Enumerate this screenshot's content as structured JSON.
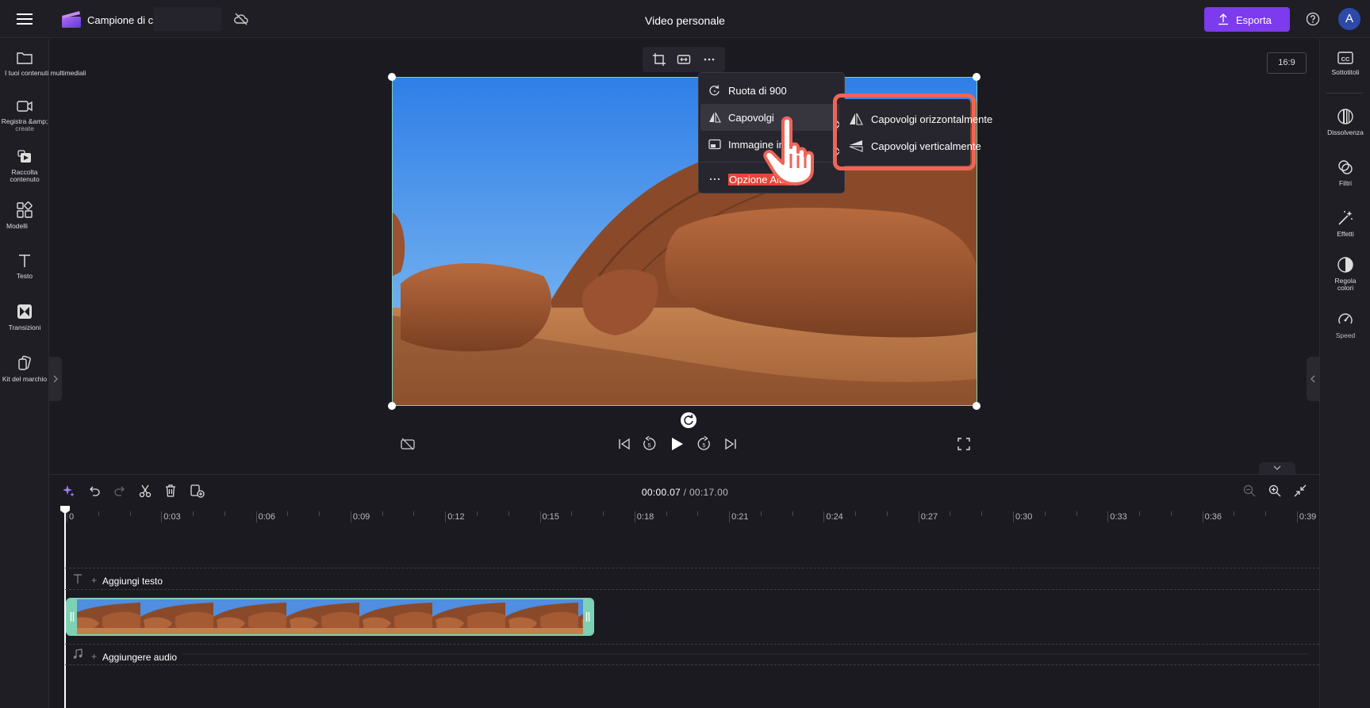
{
  "header": {
    "project_name": "Campione di clip",
    "video_title": "Video personale",
    "export_label": "Esporta",
    "avatar_initial": "A"
  },
  "left_nav": [
    {
      "label": "I tuoi contenuti multimediali",
      "icon": "folder-icon"
    },
    {
      "label": "Registra &amp;",
      "sub": "create",
      "icon": "camera-icon"
    },
    {
      "label": "Raccolta",
      "sub": "contenuto",
      "icon": "content-library-icon"
    },
    {
      "label": "Modelli",
      "icon": "templates-icon"
    },
    {
      "label": "Testo",
      "icon": "text-icon"
    },
    {
      "label": "Transizioni",
      "icon": "transitions-icon"
    },
    {
      "label": "Kit del marchio",
      "icon": "brand-kit-icon"
    }
  ],
  "right_nav": [
    {
      "label": "Sottotitoli",
      "icon": "captions-icon"
    },
    {
      "label": "Dissolvenza",
      "icon": "fade-icon"
    },
    {
      "label": "Filtri",
      "icon": "filters-icon"
    },
    {
      "label": "Effetti",
      "icon": "effects-icon"
    },
    {
      "label": "Regola",
      "sub": "colori",
      "icon": "adjust-colors-icon"
    },
    {
      "label": "Speed",
      "icon": "speed-icon"
    }
  ],
  "preview": {
    "aspect_ratio": "16:9"
  },
  "context_menu": {
    "items": [
      {
        "label": "Ruota di 900",
        "icon": "rotate-icon"
      },
      {
        "label": "Capovolgi",
        "icon": "flip-icon",
        "has_submenu": true
      },
      {
        "label": "Immagine in i",
        "icon": "picture-in-picture-icon",
        "has_submenu": true
      },
      {
        "label": "Opzione Altro",
        "icon": "more-icon"
      }
    ],
    "submenu": [
      {
        "label": "Capovolgi orizzontalmente",
        "icon": "flip-horizontal-icon"
      },
      {
        "label": "Capovolgi verticalmente",
        "icon": "flip-vertical-icon"
      }
    ]
  },
  "timeline": {
    "current_time": "00:00.07",
    "separator": " / ",
    "total_time": "00:17.00",
    "ticks": [
      "0",
      "0:03",
      "0:06",
      "0:09",
      "0:12",
      "0:15",
      "0:18",
      "0:21",
      "0:24",
      "0:27",
      "0:30",
      "0:33",
      "0:36",
      "0:39"
    ],
    "add_text_label": "Aggiungi testo",
    "add_audio_label": "Aggiungere audio"
  },
  "colors": {
    "accent": "#7c3bec",
    "selection": "#7fd1b4",
    "highlight": "#ef6458"
  }
}
